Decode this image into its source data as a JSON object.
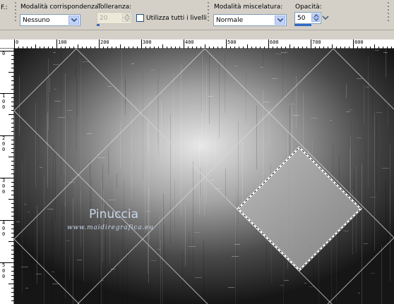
{
  "toolbar": {
    "cut_label": "F.:",
    "match_mode": {
      "label": "Modalità corrispondenza:",
      "value": "Nessuno"
    },
    "tolerance": {
      "label": "Tolleranza:",
      "value": "20"
    },
    "all_layers": {
      "label": "Utilizza tutti i livelli",
      "checked": false
    },
    "blend_mode": {
      "label": "Modalità miscelatura:",
      "value": "Normale"
    },
    "opacity": {
      "label": "Opacità:",
      "value": "50"
    }
  },
  "ruler": {
    "top_ticks": [
      "0",
      "100",
      "200",
      "300",
      "400",
      "500",
      "600",
      "700",
      "800"
    ],
    "left_ticks": [
      "0",
      "100",
      "200",
      "300",
      "400",
      "500"
    ]
  },
  "watermark": {
    "name": "Pinuccia",
    "site": "www.maidiregrafica.eu"
  },
  "colors": {
    "toolbar_bg": "#d4d0c8",
    "accent": "#316ac5",
    "canvas_dark": "#1a1a1a",
    "canvas_light": "#e0e0e0"
  }
}
